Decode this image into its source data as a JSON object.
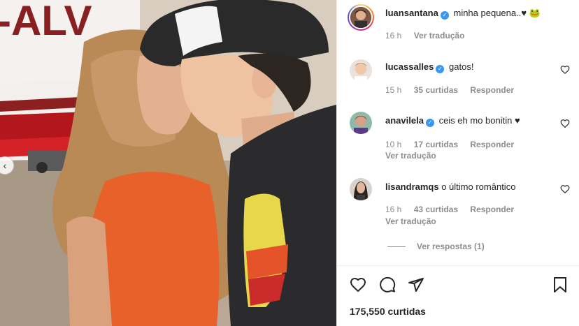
{
  "post": {
    "author": "luansantana",
    "caption": "minha pequena..♥ 🐸",
    "time": "16 h",
    "see_translation": "Ver tradução",
    "plane_registration": "-ALV"
  },
  "comments": [
    {
      "user": "lucassalles",
      "verified": true,
      "text": "gatos!",
      "time": "15 h",
      "likes": "35 curtidas",
      "reply": "Responder",
      "translate": ""
    },
    {
      "user": "anavilela",
      "verified": true,
      "text": "ceis eh mo bonitin ♥",
      "time": "10 h",
      "likes": "17 curtidas",
      "reply": "Responder",
      "translate": "Ver tradução"
    },
    {
      "user": "lisandramqs",
      "verified": false,
      "text": "o último romântico",
      "time": "16 h",
      "likes": "43 curtidas",
      "reply": "Responder",
      "translate": "Ver tradução"
    }
  ],
  "view_replies": "Ver respostas (1)",
  "likes_total": "175,550 curtidas",
  "verified_glyph": "✓",
  "colors": {
    "verified": "#3897f0",
    "muted": "#8e8e8e",
    "text": "#262626",
    "border": "#efefef"
  },
  "icons": [
    "heart-icon",
    "comment-icon",
    "share-icon",
    "bookmark-icon",
    "chevron-left-icon"
  ]
}
